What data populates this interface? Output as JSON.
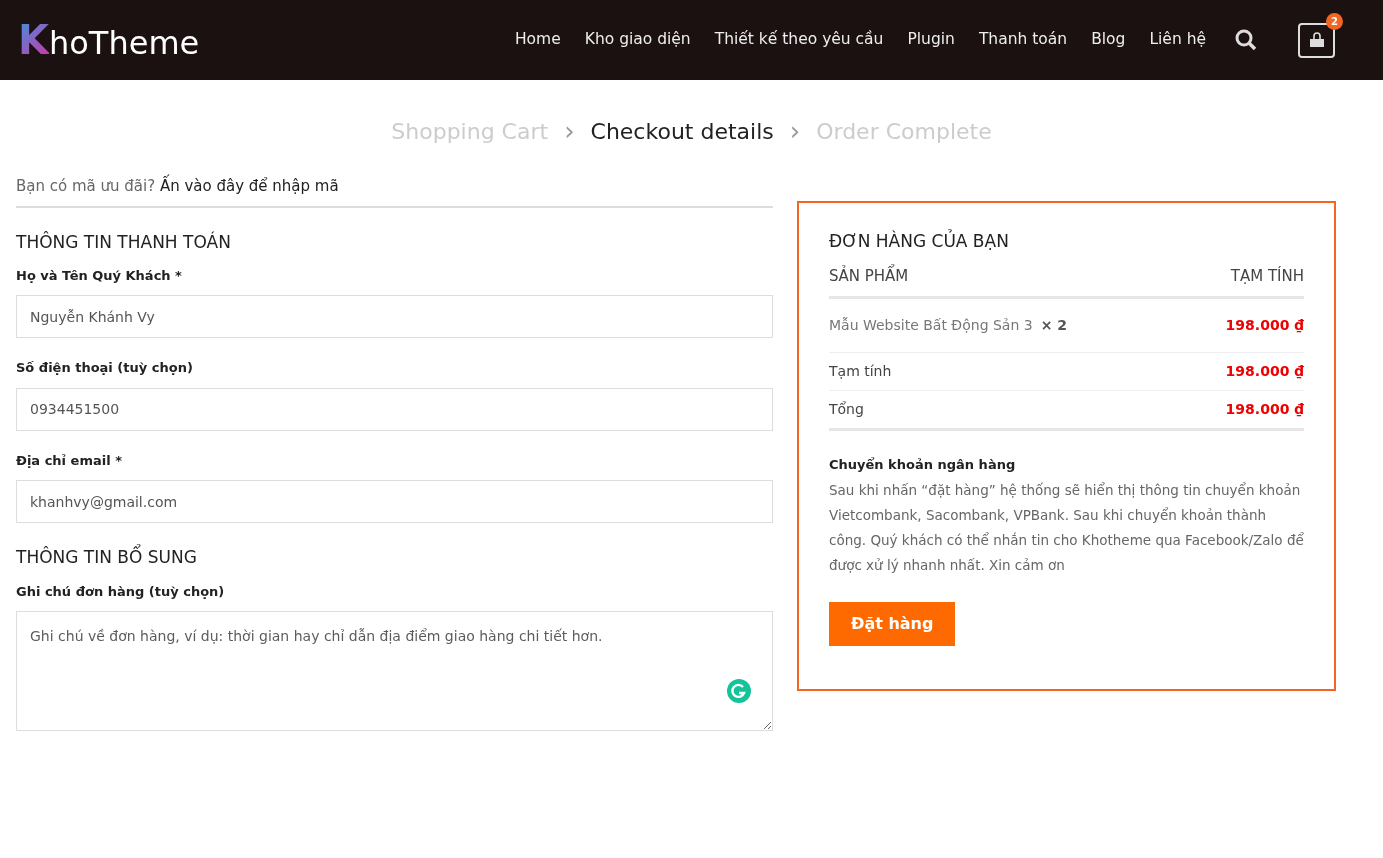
{
  "logo": {
    "initial": "K",
    "rest": "hoTheme"
  },
  "nav": [
    {
      "label": "Home"
    },
    {
      "label": "Kho giao diện"
    },
    {
      "label": "Thiết kế theo yêu cầu"
    },
    {
      "label": "Plugin"
    },
    {
      "label": "Thanh toán"
    },
    {
      "label": "Blog"
    },
    {
      "label": "Liên hệ"
    }
  ],
  "cart_count": "2",
  "steps": [
    {
      "label": "Shopping Cart",
      "selected": false
    },
    {
      "label": "Checkout details",
      "selected": true
    },
    {
      "label": "Order Complete",
      "selected": false
    }
  ],
  "step_separator": "›",
  "coupon": {
    "question": "Bạn có mã ưu đãi?",
    "link": "Ấn vào đây để nhập mã"
  },
  "billing": {
    "title": "THÔNG TIN THANH TOÁN",
    "fields": [
      {
        "label": "Họ và Tên Quý Khách *",
        "value": "Nguyễn Khánh Vy"
      },
      {
        "label": "Số điện thoại (tuỳ chọn)",
        "value": "0934451500"
      },
      {
        "label": "Địa chỉ email *",
        "value": "khanhvy@gmail.com"
      }
    ]
  },
  "additional": {
    "title": "THÔNG TIN BỔ SUNG",
    "label": "Ghi chú đơn hàng (tuỳ chọn)",
    "placeholder": "Ghi chú về đơn hàng, ví dụ: thời gian hay chỉ dẫn địa điểm giao hàng chi tiết hơn."
  },
  "order": {
    "title": "ĐƠN HÀNG CỦA BẠN",
    "columns": [
      "SẢN PHẨM",
      "TẠM TÍNH"
    ],
    "items": [
      {
        "name": "Mẫu Website Bất Động Sản 3",
        "qty": "× 2",
        "price": "198.000 ₫"
      }
    ],
    "totals": [
      {
        "label": "Tạm tính",
        "value": "198.000 ₫"
      },
      {
        "label": "Tổng",
        "value": "198.000 ₫"
      }
    ],
    "payment_title": "Chuyển khoản ngân hàng",
    "payment_text": "Sau khi nhấn “đặt hàng” hệ thống sẽ hiển thị thông tin chuyển khoản Vietcombank, Sacombank, VPBank. Sau khi chuyển khoản thành công. Quý khách có thể nhắn tin cho Khotheme qua Facebook/Zalo để được xử lý nhanh nhất. Xin cảm ơn",
    "button": "Đặt hàng"
  }
}
